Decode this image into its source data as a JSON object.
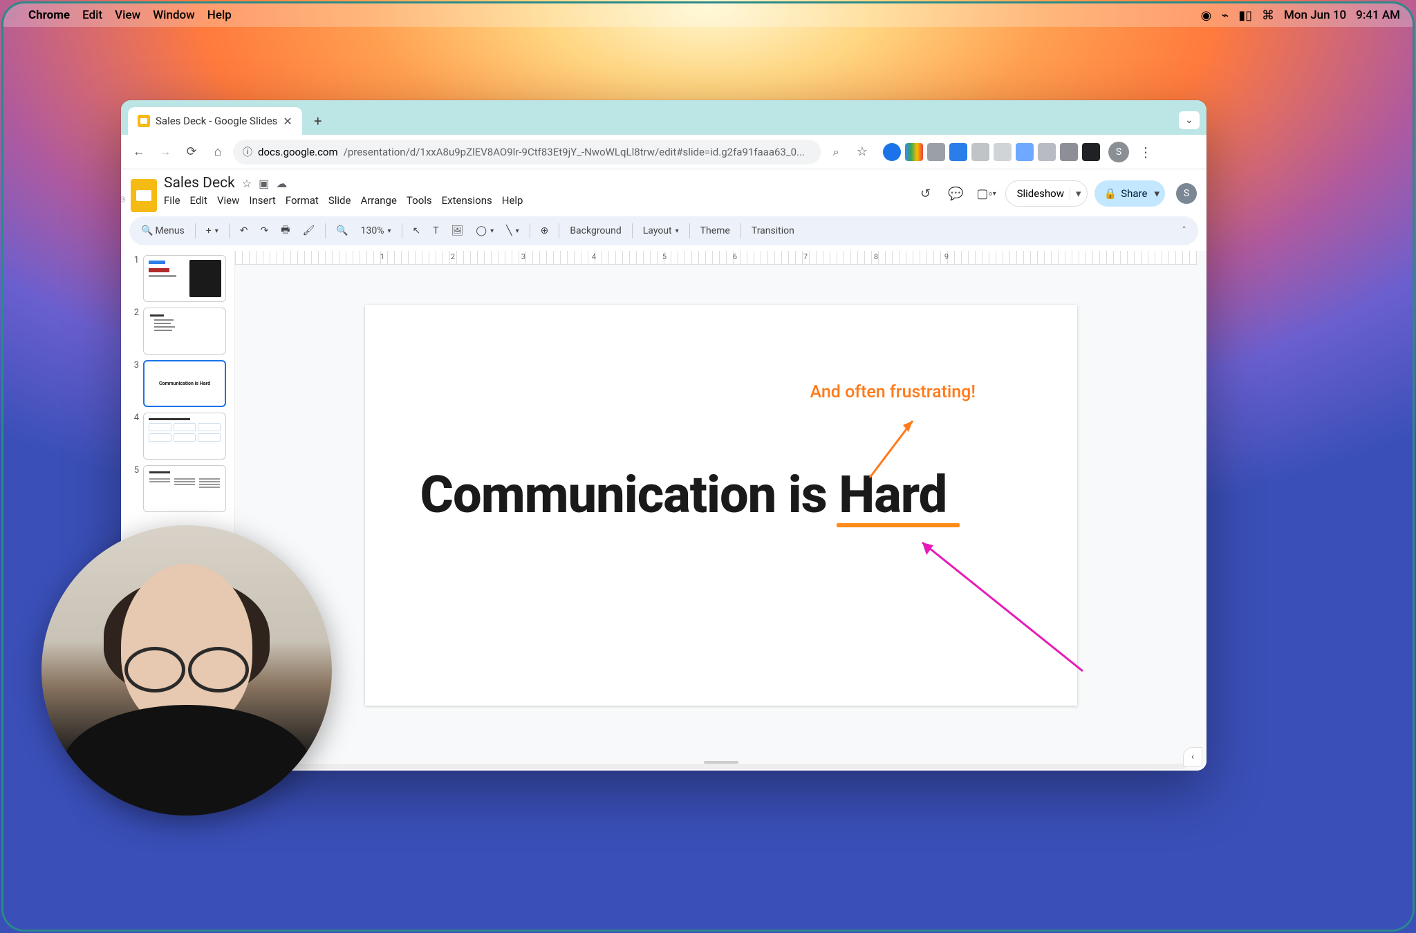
{
  "mac_menubar": {
    "app_name": "Chrome",
    "items": [
      "Edit",
      "View",
      "Window",
      "Help"
    ],
    "date": "Mon Jun 10",
    "time": "9:41 AM"
  },
  "chrome": {
    "tab_title": "Sales Deck - Google Slides",
    "url_host": "docs.google.com",
    "url_path": "/presentation/d/1xxA8u9pZlEV8AO9lr-9Ctf83Et9jY_-NwoWLqLl8trw/edit#slide=id.g2fa91faaa63_0...",
    "profile_initial": "S",
    "ext_colors": [
      "#1a73e8",
      "#34a853",
      "#9aa0a6",
      "#2b7de9",
      "#c0c4c9",
      "#d0d4d9",
      "#1a73e8",
      "#b8bcc2",
      "#8c9096",
      "#202124"
    ]
  },
  "slides": {
    "doc_title": "Sales Deck",
    "menus": [
      "File",
      "Edit",
      "View",
      "Insert",
      "Format",
      "Slide",
      "Arrange",
      "Tools",
      "Extensions",
      "Help"
    ],
    "share_label": "Share",
    "slideshow_label": "Slideshow",
    "toolbar": {
      "search": "Menus",
      "zoom": "130%",
      "background": "Background",
      "layout": "Layout",
      "theme": "Theme",
      "transition": "Transition"
    },
    "ruler_ticks": [
      "",
      "1",
      "2",
      "3",
      "4",
      "5",
      "6",
      "7",
      "8",
      "9"
    ],
    "thumbnails": [
      {
        "num": "1",
        "selected": false,
        "preview": "title"
      },
      {
        "num": "2",
        "selected": false,
        "preview": "agenda"
      },
      {
        "num": "3",
        "selected": true,
        "preview": "headline"
      },
      {
        "num": "4",
        "selected": false,
        "preview": "grid"
      },
      {
        "num": "5",
        "selected": false,
        "preview": "columns"
      }
    ],
    "current_slide": {
      "headline": "Communication is Hard",
      "annotation": "And often frustrating!"
    }
  }
}
